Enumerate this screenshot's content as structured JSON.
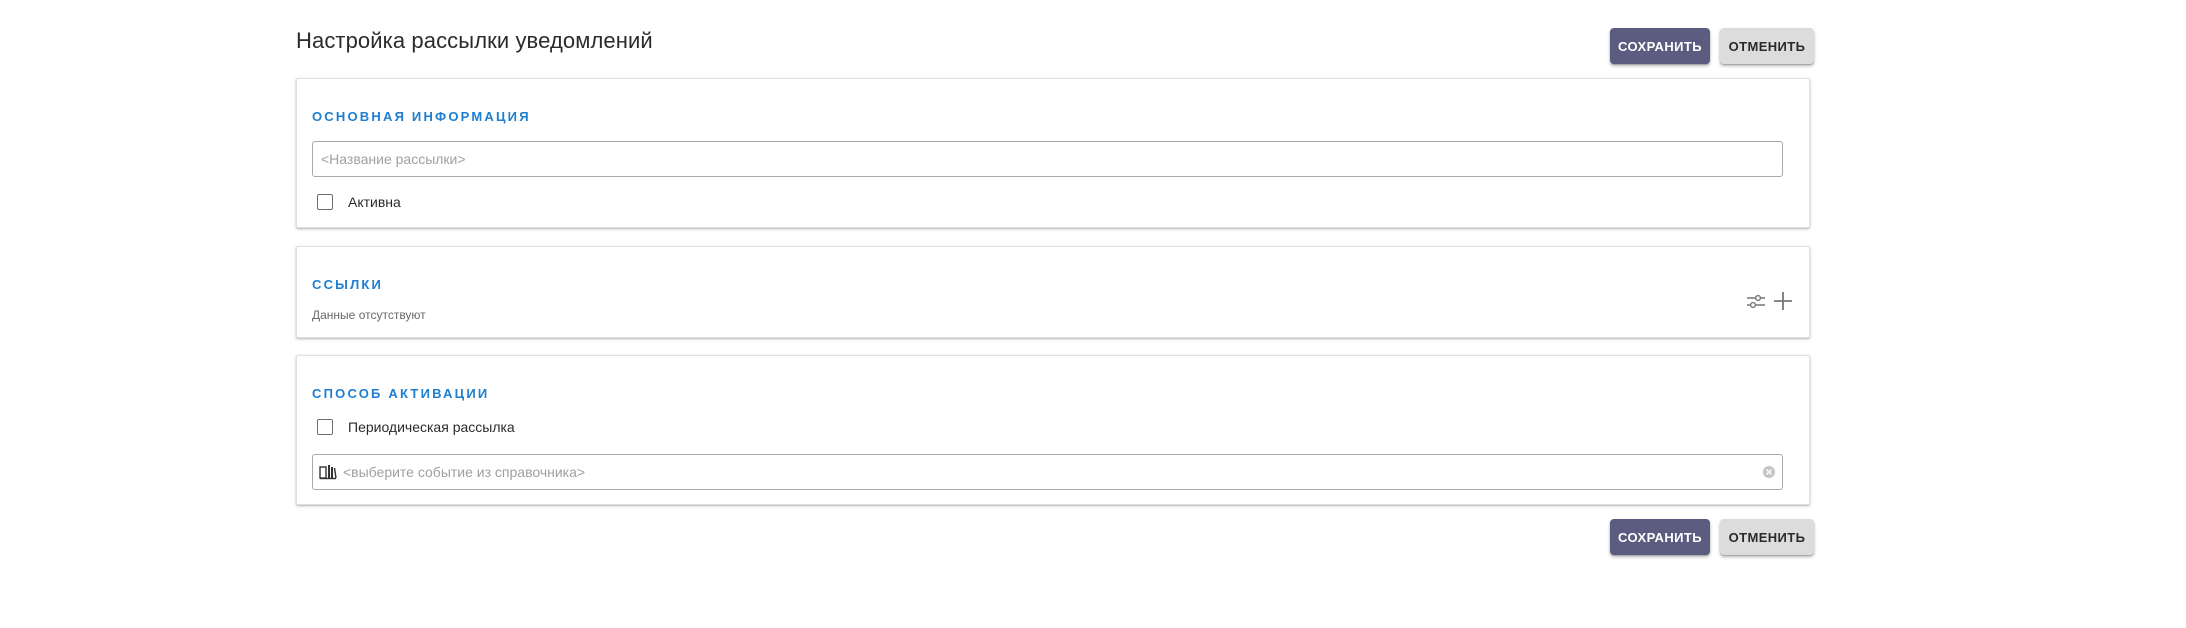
{
  "page": {
    "title": "Настройка рассылки уведомлений"
  },
  "actions": {
    "save_label": "СОХРАНИТЬ",
    "cancel_label": "ОТМЕНИТЬ"
  },
  "sections": {
    "basic": {
      "title": "ОСНОВНАЯ ИНФОРМАЦИЯ",
      "name_placeholder": "<Название рассылки>",
      "name_value": "",
      "active_label": "Активна",
      "active_checked": false
    },
    "links": {
      "title": "ССЫЛКИ",
      "empty_text": "Данные отсутствуют",
      "filter_icon": "tune-icon",
      "add_icon": "plus-icon"
    },
    "activation": {
      "title": "СПОСОБ АКТИВАЦИИ",
      "periodic_label": "Периодическая рассылка",
      "periodic_checked": false,
      "event_placeholder": "<выберите событие из справочника>",
      "dictionary_icon": "book-icon",
      "clear_icon": "clear-icon"
    }
  },
  "colors": {
    "accent": "#1e7ed0",
    "primary_button": "#5c5c80",
    "secondary_button": "#dcdcdc"
  }
}
